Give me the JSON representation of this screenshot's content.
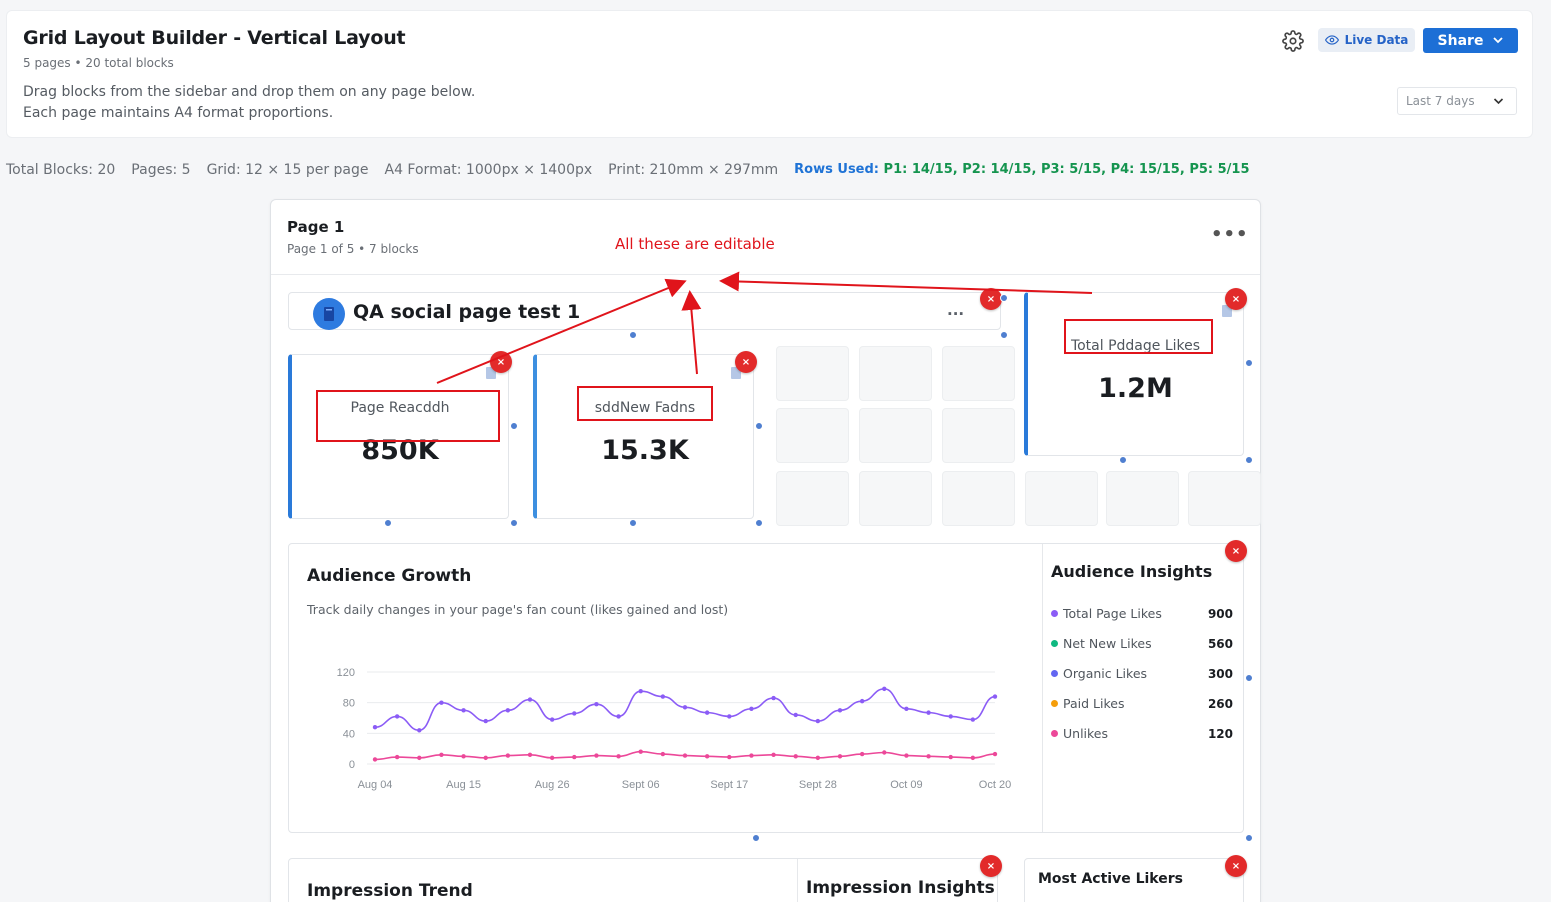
{
  "header": {
    "title": "Grid Layout Builder - Vertical Layout",
    "subtitle": "5 pages • 20 total blocks",
    "description_line1": "Drag blocks from the sidebar and drop them on any page below.",
    "description_line2": "Each page maintains A4 format proportions.",
    "live_data_label": "Live Data",
    "share_label": "Share",
    "date_range": "Last 7 days"
  },
  "stats": {
    "total_blocks": "Total Blocks: 20",
    "pages": "Pages: 5",
    "grid": "Grid: 12 × 15 per page",
    "a4_format": "A4 Format: 1000px × 1400px",
    "print": "Print: 210mm × 297mm",
    "rows_used_label": "Rows Used:",
    "rows_used": [
      "P1: 14/15,",
      "P2: 14/15,",
      "P3: 5/15,",
      "P4: 15/15,",
      "P5: 5/15"
    ]
  },
  "page": {
    "title": "Page 1",
    "subtitle": "Page 1 of 5 • 7 blocks",
    "more_label": "•••",
    "annotation": "All these are editable"
  },
  "blocks": {
    "qa_title": "QA social page test 1",
    "qa_more": "...",
    "metrics": [
      {
        "label": "Page Reacddh",
        "value": "850K"
      },
      {
        "label": "sddNew Fadns",
        "value": "15.3K"
      },
      {
        "label": "Total Pddage Likes",
        "value": "1.2M"
      }
    ],
    "audience": {
      "title": "Audience Growth",
      "subtitle": "Track daily changes in your page's fan count (likes gained and lost)"
    },
    "insights": {
      "title": "Audience Insights",
      "items": [
        {
          "label": "Total Page Likes",
          "value": "900",
          "color": "#8b5cf6"
        },
        {
          "label": "Net New Likes",
          "value": "560",
          "color": "#10b981"
        },
        {
          "label": "Organic Likes",
          "value": "300",
          "color": "#6366f1"
        },
        {
          "label": "Paid Likes",
          "value": "260",
          "color": "#f59e0b"
        },
        {
          "label": "Unlikes",
          "value": "120",
          "color": "#ec4899"
        }
      ]
    },
    "impression_trend_title": "Impression Trend",
    "impression_insights_title": "Impression Insights",
    "most_active_title": "Most Active Likers",
    "close_label": "×"
  },
  "chart_data": {
    "type": "line",
    "title": "Audience Growth",
    "x_ticks": [
      "Aug 04",
      "Aug 15",
      "Aug 26",
      "Sept 06",
      "Sept 17",
      "Sept 28",
      "Oct 09",
      "Oct 20"
    ],
    "y_ticks": [
      "0",
      "40",
      "80",
      "120"
    ],
    "ylim": [
      0,
      120
    ],
    "grid": true,
    "series": [
      {
        "color": "#8b5cf6",
        "values": [
          48,
          62,
          44,
          80,
          70,
          56,
          70,
          84,
          58,
          66,
          78,
          62,
          95,
          88,
          74,
          67,
          62,
          72,
          86,
          64,
          56,
          70,
          82,
          98,
          72,
          67,
          62,
          58,
          88
        ]
      },
      {
        "color": "#ec4899",
        "values": [
          6,
          9,
          8,
          12,
          10,
          8,
          11,
          12,
          8,
          9,
          11,
          10,
          16,
          13,
          11,
          10,
          9,
          11,
          12,
          10,
          8,
          10,
          13,
          15,
          11,
          10,
          9,
          8,
          13
        ]
      }
    ]
  },
  "colors": {
    "accent": "#1d6fd6",
    "close": "#e22a2a",
    "annotation": "#e0141b"
  }
}
